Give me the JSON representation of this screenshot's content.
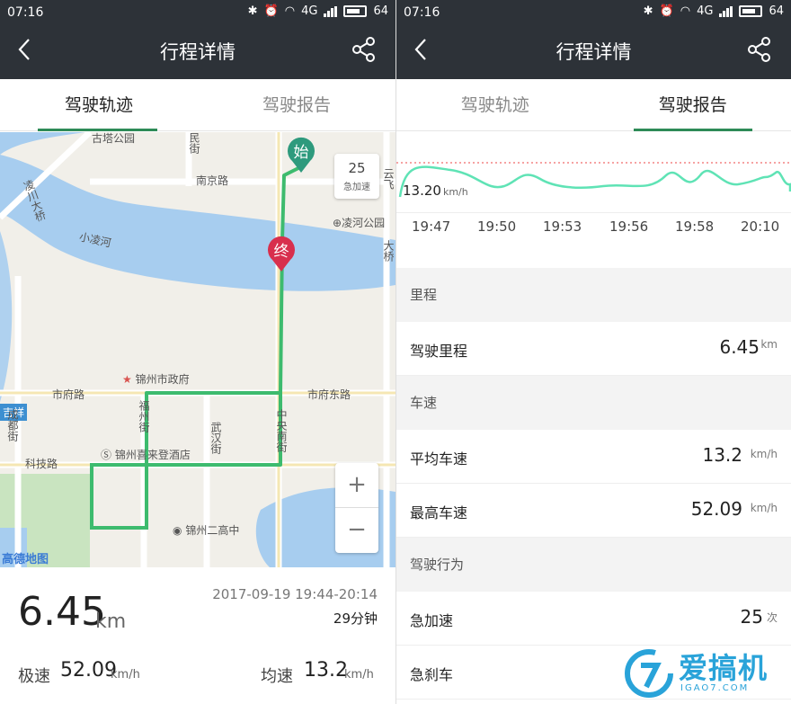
{
  "status": {
    "time": "07:16",
    "battery": "64",
    "network": "4G"
  },
  "nav": {
    "title": "行程详情"
  },
  "tabs": {
    "track": "驾驶轨迹",
    "report": "驾驶报告"
  },
  "map": {
    "labels": {
      "guta_park": "古塔公园",
      "minzhu_street": "民街",
      "nanjing_road": "南京路",
      "linghe_park": "凌河公园",
      "xiaolinghe": "小凌河",
      "linghe_bridge": "凌川大桥",
      "yunfei": "云飞",
      "jixiang": "吉祥",
      "daqiao": "大桥",
      "city_gov": "锦州市政府",
      "shifu_road": "市府路",
      "shifu_east_road": "市府东路",
      "chengdu_street": "成都街",
      "fuzhou_street": "福州街",
      "wuhan_street": "武汉街",
      "zhongyang_street": "中央南街",
      "keji_road": "科技路",
      "hotel": "锦州喜来登酒店",
      "school": "锦州二高中",
      "logo": "高德地图"
    },
    "start_label": "始",
    "end_label": "终",
    "event_counter": {
      "value": "25",
      "label": "急加速"
    },
    "zoom_in": "+",
    "zoom_out": "−",
    "route_color": "#3dbb6e"
  },
  "summary": {
    "distance": "6.45",
    "distance_unit": "km",
    "date_range": "2017-09-19 19:44-20:14",
    "duration": "29分钟",
    "max_label": "极速",
    "max_value": "52.09",
    "max_unit": "km/h",
    "avg_label": "均速",
    "avg_value": "13.2",
    "avg_unit": "km/h"
  },
  "chart_data": {
    "type": "line",
    "x": [
      "19:47",
      "19:50",
      "19:53",
      "19:56",
      "19:58",
      "20:10"
    ],
    "reference_value": "13.20",
    "reference_unit": "km/h",
    "line_color": "#5fe3b5"
  },
  "report": {
    "sections": [
      {
        "title": "里程",
        "rows": [
          {
            "label": "驾驶里程",
            "value": "6.45",
            "unit": "km"
          }
        ]
      },
      {
        "title": "车速",
        "rows": [
          {
            "label": "平均车速",
            "value": "13.2",
            "unit": "km/h"
          },
          {
            "label": "最高车速",
            "value": "52.09",
            "unit": "km/h"
          }
        ]
      },
      {
        "title": "驾驶行为",
        "rows": [
          {
            "label": "急加速",
            "value": "25",
            "unit": "次"
          },
          {
            "label": "急刹车",
            "value": "",
            "unit": ""
          }
        ]
      }
    ]
  },
  "watermark": {
    "brand": "爱搞机",
    "sub": "IGAO7.COM"
  }
}
